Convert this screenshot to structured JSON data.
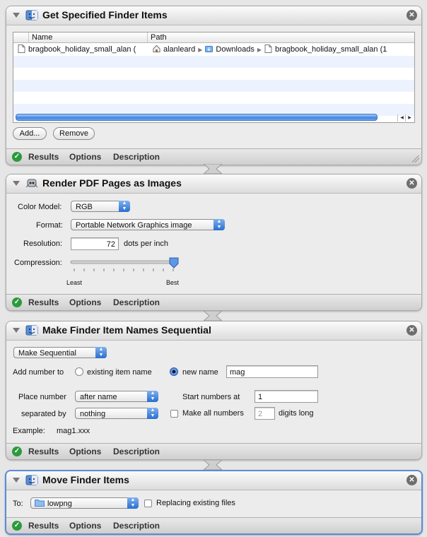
{
  "actions": [
    {
      "title": "Get Specified Finder Items",
      "table": {
        "columns": [
          "Name",
          "Path"
        ],
        "rows": [
          {
            "name": "bragbook_holiday_small_alan (",
            "path": [
              "alanleard",
              "Downloads",
              "bragbook_holiday_small_alan (1"
            ]
          }
        ]
      },
      "buttons": {
        "add": "Add...",
        "remove": "Remove"
      }
    },
    {
      "title": "Render PDF Pages as Images",
      "color_model": {
        "label": "Color Model:",
        "value": "RGB"
      },
      "format": {
        "label": "Format:",
        "value": "Portable Network Graphics image"
      },
      "resolution": {
        "label": "Resolution:",
        "value": "72",
        "unit": "dots per inch"
      },
      "compression": {
        "label": "Compression:",
        "min_label": "Least",
        "max_label": "Best",
        "level": 1.0
      }
    },
    {
      "title": "Make Finder Item Names Sequential",
      "mode": "Make Sequential",
      "add_number_to": {
        "label": "Add number to",
        "option_existing": "existing item name",
        "option_new": "new name",
        "new_name_value": "mag",
        "selected": "new name"
      },
      "place_number": {
        "label": "Place number",
        "value": "after name"
      },
      "separated_by": {
        "label": "separated by",
        "value": "nothing"
      },
      "start_numbers": {
        "label": "Start numbers at",
        "value": "1"
      },
      "make_all_numbers": {
        "label": "Make all numbers",
        "value": "2",
        "suffix": "digits long",
        "checked": false
      },
      "example": {
        "label": "Example:",
        "value": "mag1.xxx"
      }
    },
    {
      "title": "Move Finder Items",
      "to": {
        "label": "To:",
        "value": "lowpng"
      },
      "replacing": {
        "label": "Replacing existing files",
        "checked": false
      }
    }
  ],
  "footer_tabs": {
    "results": "Results",
    "options": "Options",
    "description": "Description"
  },
  "close_glyph": "✕",
  "ok_glyph": "✓",
  "colors": {
    "selection_border": "#5b8bd6",
    "popup_accent": "#2a6fd0",
    "status_ok": "#2b9a3b"
  }
}
